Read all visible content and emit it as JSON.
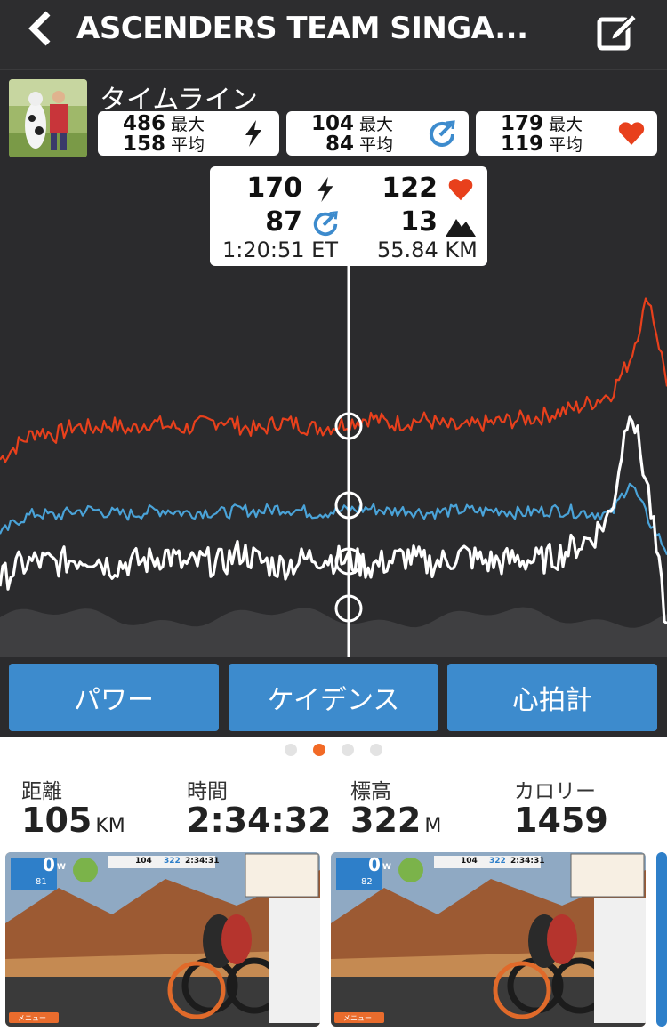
{
  "header": {
    "title": "ASCENDERS TEAM SINGA...",
    "back_icon": "chevron-left-icon",
    "edit_icon": "edit-icon"
  },
  "timeline": {
    "label": "タイムライン",
    "power": {
      "max": "486",
      "avg": "158",
      "max_label": "最大",
      "avg_label": "平均",
      "icon": "lightning-icon"
    },
    "cadence": {
      "max": "104",
      "avg": "84",
      "max_label": "最大",
      "avg_label": "平均",
      "icon": "cadence-icon"
    },
    "heart_rate": {
      "max": "179",
      "avg": "119",
      "max_label": "最大",
      "avg_label": "平均",
      "icon": "heart-icon"
    }
  },
  "tooltip": {
    "power": "170",
    "heart_rate": "122",
    "cadence": "87",
    "elevation": "13",
    "elapsed_time": "1:20:51 ET",
    "distance": "55.84 KM"
  },
  "tabs": {
    "power": "パワー",
    "cadence": "ケイデンス",
    "heart_rate": "心拍計"
  },
  "pager": {
    "count": 4,
    "active": 1
  },
  "summary": {
    "distance": {
      "label": "距離",
      "value": "105",
      "unit": "KM"
    },
    "time": {
      "label": "時間",
      "value": "2:34:32"
    },
    "elevation": {
      "label": "標高",
      "value": "322",
      "unit": "M"
    },
    "calories": {
      "label": "カロリー",
      "value": "1459"
    }
  },
  "screenshots": [
    {
      "hud_power": "0",
      "hud_unit": "W",
      "hud_cadence": "81",
      "hud_top": "104",
      "hud_elev": "322",
      "hud_time": "2:34:31",
      "menu_label": "メニュー"
    },
    {
      "hud_power": "0",
      "hud_unit": "W",
      "hud_cadence": "82",
      "hud_top": "104",
      "hud_elev": "322",
      "hud_time": "2:34:31",
      "menu_label": "メニュー"
    }
  ],
  "colors": {
    "power_line": "#ffffff",
    "heart_line": "#e8401c",
    "cadence_line": "#4aa3d8",
    "elevation_fill": "#3f3f41",
    "button_blue": "#3d8bcd",
    "active_dot": "#f26a26"
  },
  "chart_data": {
    "type": "line",
    "x_marker": "1:20:51 ET",
    "series": [
      {
        "name": "heart_rate",
        "values": [
          105,
          112,
          118,
          116,
          120,
          119,
          121,
          118,
          122,
          120,
          119,
          121,
          123,
          120,
          118,
          122,
          121,
          119,
          120,
          122,
          124,
          121,
          122,
          123,
          120,
          119,
          121,
          122,
          123,
          124,
          126,
          128,
          131,
          135,
          150,
          179,
          140
        ]
      },
      {
        "name": "cadence",
        "values": [
          70,
          80,
          84,
          82,
          85,
          86,
          84,
          83,
          85,
          86,
          84,
          85,
          84,
          86,
          85,
          87,
          86,
          84,
          85,
          86,
          87,
          85,
          86,
          84,
          85,
          86,
          85,
          86,
          84,
          85,
          86,
          85,
          84,
          83,
          104,
          80,
          60
        ]
      },
      {
        "name": "power",
        "values": [
          120,
          150,
          160,
          155,
          165,
          170,
          150,
          158,
          160,
          175,
          150,
          160,
          155,
          180,
          160,
          150,
          158,
          170,
          165,
          160,
          150,
          160,
          170,
          155,
          160,
          175,
          160,
          158,
          165,
          160,
          170,
          190,
          210,
          260,
          486,
          300,
          20
        ]
      }
    ]
  }
}
